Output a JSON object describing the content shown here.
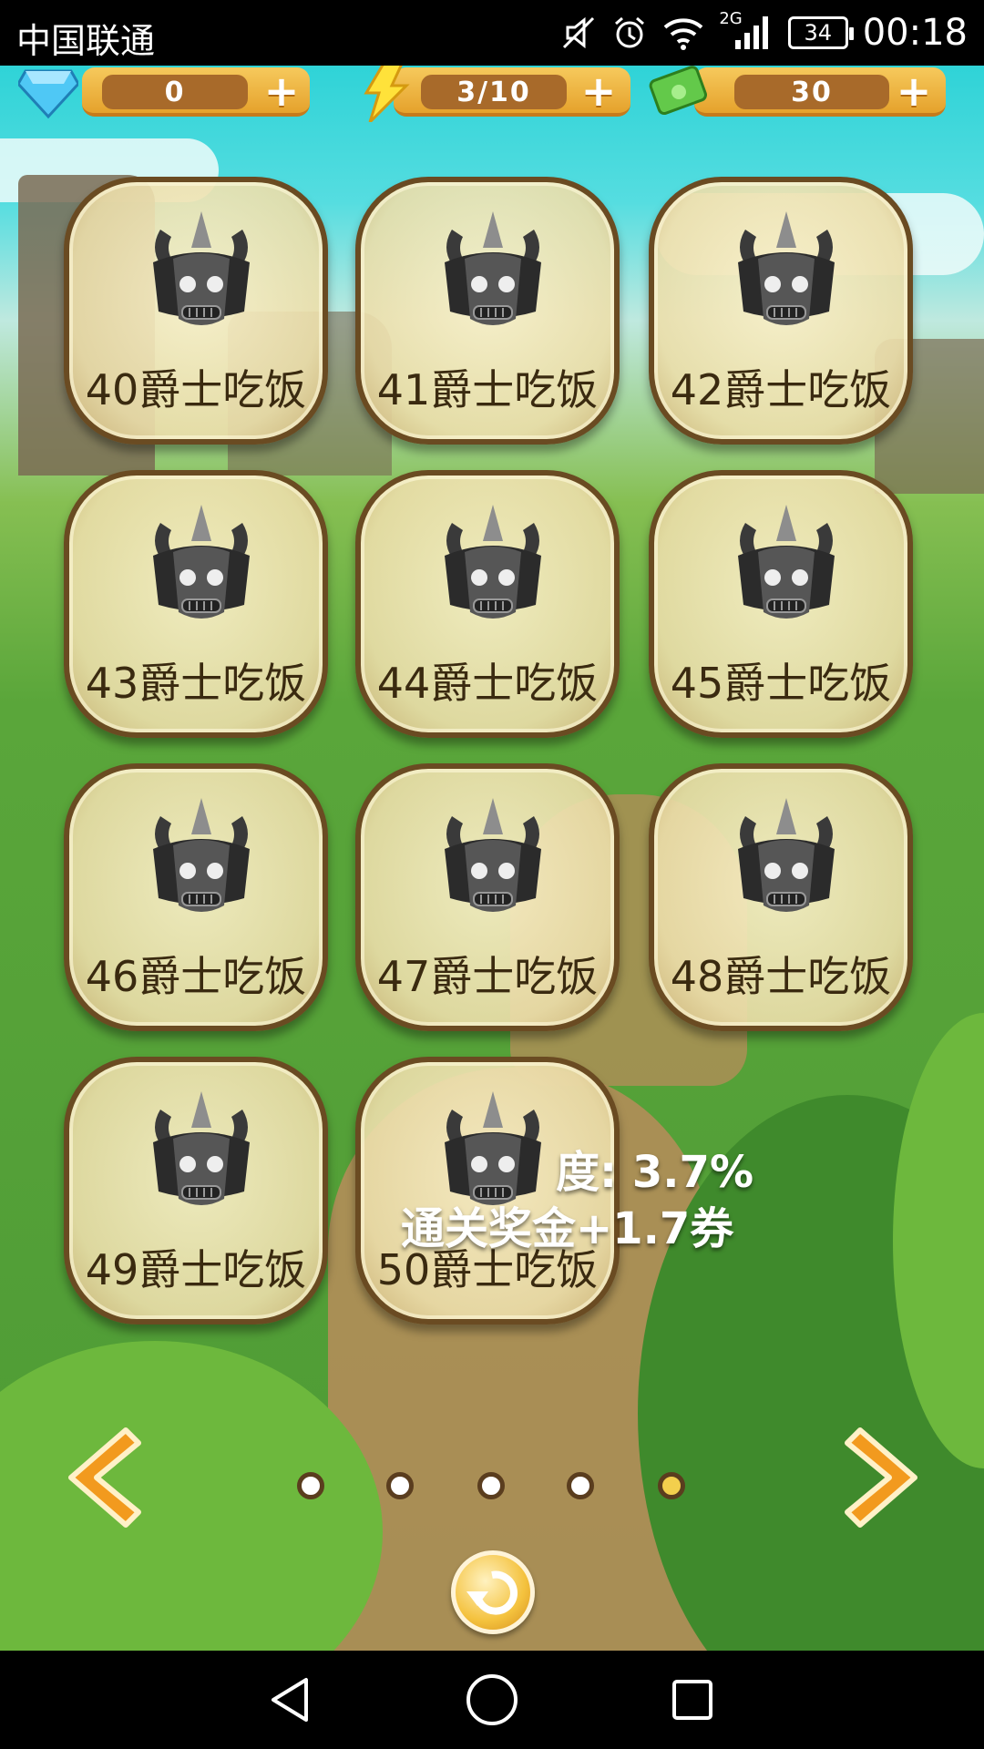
{
  "status_bar": {
    "carrier": "中国联通",
    "network": "2G",
    "battery": "34",
    "time": "00:18"
  },
  "currency": {
    "gems": "0",
    "energy": "3/10",
    "cash": "30"
  },
  "levels": [
    {
      "label": "40爵士吃饭"
    },
    {
      "label": "41爵士吃饭"
    },
    {
      "label": "42爵士吃饭"
    },
    {
      "label": "43爵士吃饭"
    },
    {
      "label": "44爵士吃饭"
    },
    {
      "label": "45爵士吃饭"
    },
    {
      "label": "46爵士吃饭"
    },
    {
      "label": "47爵士吃饭"
    },
    {
      "label": "48爵士吃饭"
    },
    {
      "label": "49爵士吃饭"
    },
    {
      "label": "50爵士吃饭"
    }
  ],
  "progress": {
    "line1": "度: 3.7%",
    "line2": "通关奖金+1.7券"
  },
  "pagination": {
    "total": 5,
    "active": 5
  },
  "colors": {
    "accent": "#f3cf4d",
    "tile_border": "#6a4b22",
    "arrow": "#f29a1e"
  }
}
